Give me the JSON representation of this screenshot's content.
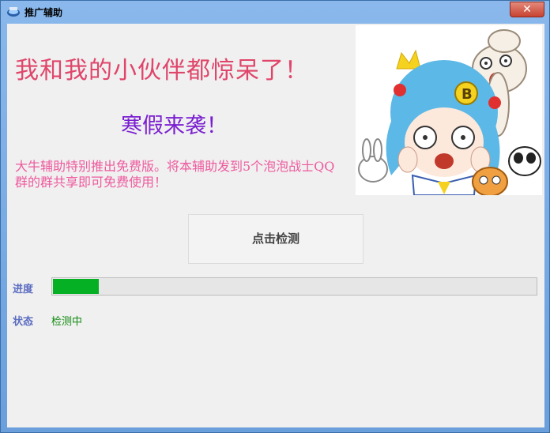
{
  "window": {
    "title": "推广辅助",
    "close_label": "✕"
  },
  "main": {
    "headline": "我和我的小伙伴都惊呆了！",
    "subhead": "寒假来袭！",
    "promo": "大牛辅助特别推出免费版。将本辅助发到5个泡泡战士QQ群的群共享即可免费使用！",
    "check_button": "点击检测"
  },
  "progress": {
    "label": "进度",
    "value": 0.095,
    "color": "#06b025"
  },
  "status": {
    "label": "状态",
    "value": "检测中"
  },
  "icons": {
    "app": "app-icon",
    "close": "close-icon"
  }
}
